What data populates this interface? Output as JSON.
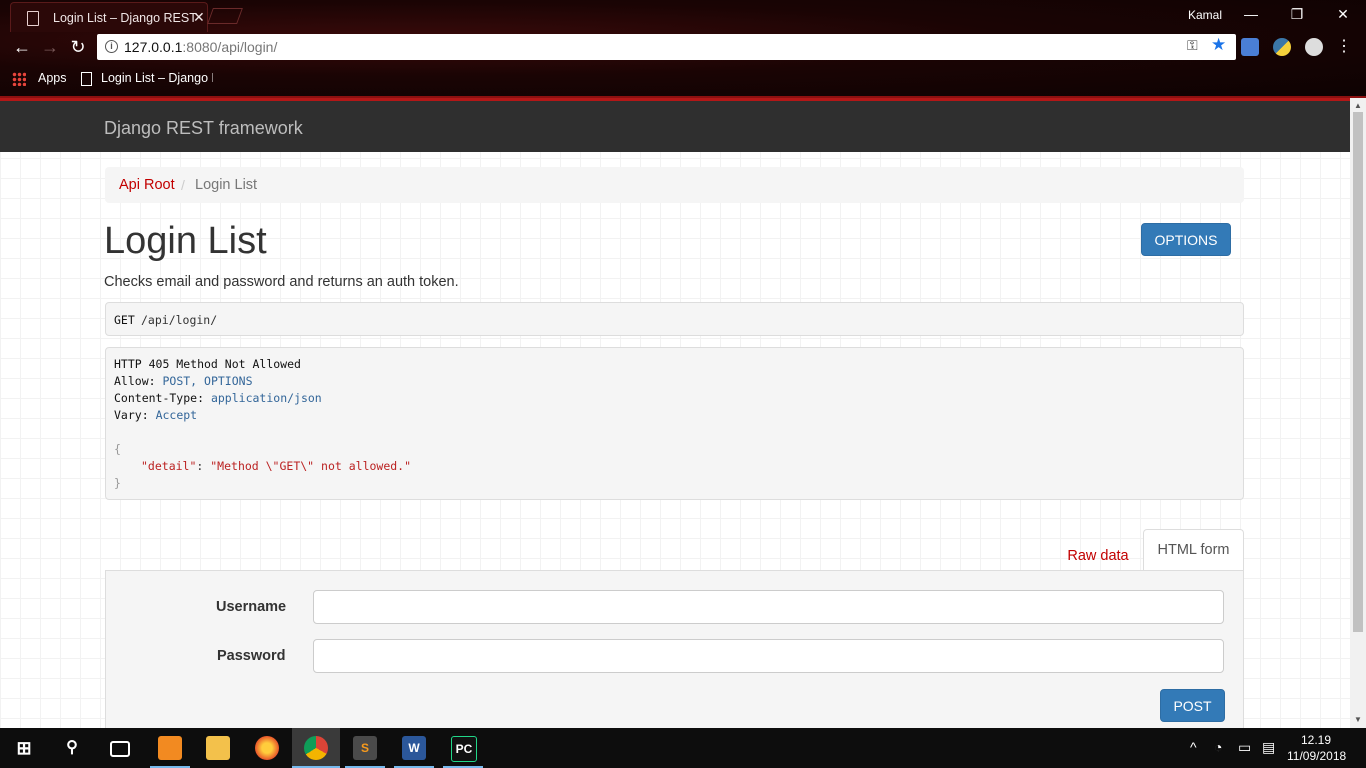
{
  "browser": {
    "tab_title": "Login List – Django REST",
    "profile_name": "Kamal",
    "url_host": "127.0.0.1",
    "url_rest": ":8080/api/login/",
    "bookmarks": {
      "apps_label": "Apps",
      "item_label": "Login List – Django R"
    },
    "window_controls": {
      "minimize": "—",
      "restore": "❐",
      "close": "✕"
    },
    "nav": {
      "back": "←",
      "forward": "→",
      "reload": "↻"
    }
  },
  "navbar": {
    "brand": "Django REST framework"
  },
  "breadcrumb": {
    "root": "Api Root",
    "separator": "/",
    "current": "Login List"
  },
  "content": {
    "title": "Login List",
    "options_label": "OPTIONS",
    "description": "Checks email and password and returns an auth token.",
    "request": {
      "method": "GET",
      "path": "/api/login/"
    },
    "response": {
      "status_line": "HTTP 405 Method Not Allowed",
      "headers": [
        {
          "name": "Allow:",
          "value": "POST, OPTIONS"
        },
        {
          "name": "Content-Type:",
          "value": "application/json"
        },
        {
          "name": "Vary:",
          "value": "Accept"
        }
      ],
      "body_open": "{",
      "body_key": "\"detail\"",
      "body_colon": ": ",
      "body_value": "\"Method \\\"GET\\\" not allowed.\"",
      "body_close": "}"
    }
  },
  "form": {
    "tabs": {
      "raw": "Raw data",
      "html": "HTML form"
    },
    "active_tab": "HTML form",
    "fields": [
      {
        "label": "Username",
        "value": ""
      },
      {
        "label": "Password",
        "value": ""
      }
    ],
    "submit_label": "POST"
  },
  "taskbar": {
    "time": "12.19",
    "date": "11/09/2018",
    "apps": [
      "start-icon",
      "search-icon",
      "task-view-icon",
      "xampp-icon",
      "file-explorer-icon",
      "firefox-icon",
      "chrome-icon",
      "sublime-text-icon",
      "word-icon",
      "pycharm-icon"
    ],
    "active_app": "chrome-icon"
  },
  "colors": {
    "link_red": "#c20000",
    "primary_button": "#337ab7",
    "navbar_bg": "#2f2f2f",
    "chrome_accent": "#8c1010"
  }
}
